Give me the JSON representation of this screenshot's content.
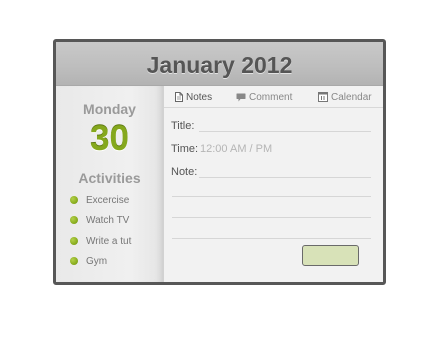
{
  "header": {
    "title": "January 2012"
  },
  "sidebar": {
    "day_name": "Monday",
    "day_number": "30",
    "activities_title": "Activities",
    "activities": [
      {
        "label": "Excercise"
      },
      {
        "label": "Watch TV"
      },
      {
        "label": "Write a tut"
      },
      {
        "label": "Gym"
      }
    ]
  },
  "tabs": [
    {
      "label": "Notes",
      "icon": "document-icon",
      "active": true
    },
    {
      "label": "Comment",
      "icon": "speech-bubble-icon",
      "active": false
    },
    {
      "label": "Calendar",
      "icon": "calendar-icon",
      "active": false
    }
  ],
  "form": {
    "title_label": "Title:",
    "time_label": "Time:",
    "time_value": "12:00 AM / PM",
    "note_label": "Note:"
  },
  "colors": {
    "accent_green": "#85a81d",
    "button_fill": "#d8e2b8",
    "frame": "#575757"
  }
}
